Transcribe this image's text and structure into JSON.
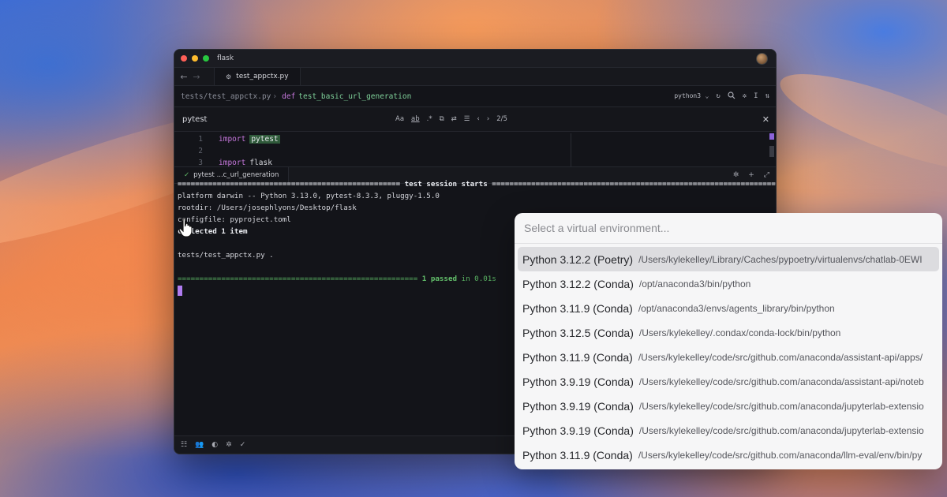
{
  "window": {
    "title": "flask",
    "traffic_lights": {
      "close": "#ff5f57",
      "minimize": "#febc2e",
      "maximize": "#28c840"
    }
  },
  "tabbar": {
    "back_icon": "arrow-left-icon",
    "forward_icon": "arrow-right-icon",
    "active_tab": "test_appctx.py"
  },
  "breadcrumb": {
    "path": "tests/test_appctx.py",
    "separator": "›",
    "keyword": "def",
    "function": "test_basic_url_generation"
  },
  "toolbar": {
    "kernel": "python3",
    "kernel_chevron": "⌄"
  },
  "find": {
    "query": "pytest",
    "case_label": "Aa",
    "word_label": "ab",
    "regex_label": ".*",
    "match_count": "2/5"
  },
  "code": {
    "lines": [
      {
        "number": "1",
        "keyword": "import",
        "identifier": "pytest"
      },
      {
        "number": "2",
        "keyword": "",
        "identifier": ""
      },
      {
        "number": "3",
        "keyword": "import",
        "identifier": "flask"
      }
    ]
  },
  "terminal_tab": {
    "label": "pytest ...c_url_generation"
  },
  "terminal": {
    "session_header_left": "===================================================",
    "session_header_title": " test session starts ",
    "session_header_right": "=================================================================",
    "platform": "platform darwin -- Python 3.13.0, pytest-8.3.3, pluggy-1.5.0",
    "rootdir": "rootdir: /Users/josephlyons/Desktop/flask",
    "configfile": "configfile: pyproject.toml",
    "collected": "collected 1 item",
    "test_line": "tests/test_appctx.py .",
    "result_bar": "=======================================================",
    "result_passed": " 1 passed",
    "result_time": " in 0.01s"
  },
  "picker": {
    "placeholder": "Select a virtual environment...",
    "environments": [
      {
        "name": "Python 3.12.2 (Poetry)",
        "path": "/Users/kylekelley/Library/Caches/pypoetry/virtualenvs/chatlab-0EWI",
        "selected": true
      },
      {
        "name": "Python 3.12.2 (Conda)",
        "path": "/opt/anaconda3/bin/python",
        "selected": false
      },
      {
        "name": "Python 3.11.9 (Conda)",
        "path": "/opt/anaconda3/envs/agents_library/bin/python",
        "selected": false
      },
      {
        "name": "Python 3.12.5 (Conda)",
        "path": "/Users/kylekelley/.condax/conda-lock/bin/python",
        "selected": false
      },
      {
        "name": "Python 3.11.9 (Conda)",
        "path": "/Users/kylekelley/code/src/github.com/anaconda/assistant-api/apps/",
        "selected": false
      },
      {
        "name": "Python 3.9.19 (Conda)",
        "path": "/Users/kylekelley/code/src/github.com/anaconda/assistant-api/noteb",
        "selected": false
      },
      {
        "name": "Python 3.9.19 (Conda)",
        "path": "/Users/kylekelley/code/src/github.com/anaconda/jupyterlab-extensio",
        "selected": false
      },
      {
        "name": "Python 3.9.19 (Conda)",
        "path": "/Users/kylekelley/code/src/github.com/anaconda/jupyterlab-extensio",
        "selected": false
      },
      {
        "name": "Python 3.11.9 (Conda)",
        "path": "/Users/kylekelley/code/src/github.com/anaconda/llm-eval/env/bin/py",
        "selected": false
      }
    ]
  },
  "colors": {
    "selected_row": "#dcdcdf",
    "cursor": "#b07cf0",
    "pass_green": "#63c06b",
    "keyword_purple": "#c678dd",
    "function_green": "#7fd19a"
  }
}
